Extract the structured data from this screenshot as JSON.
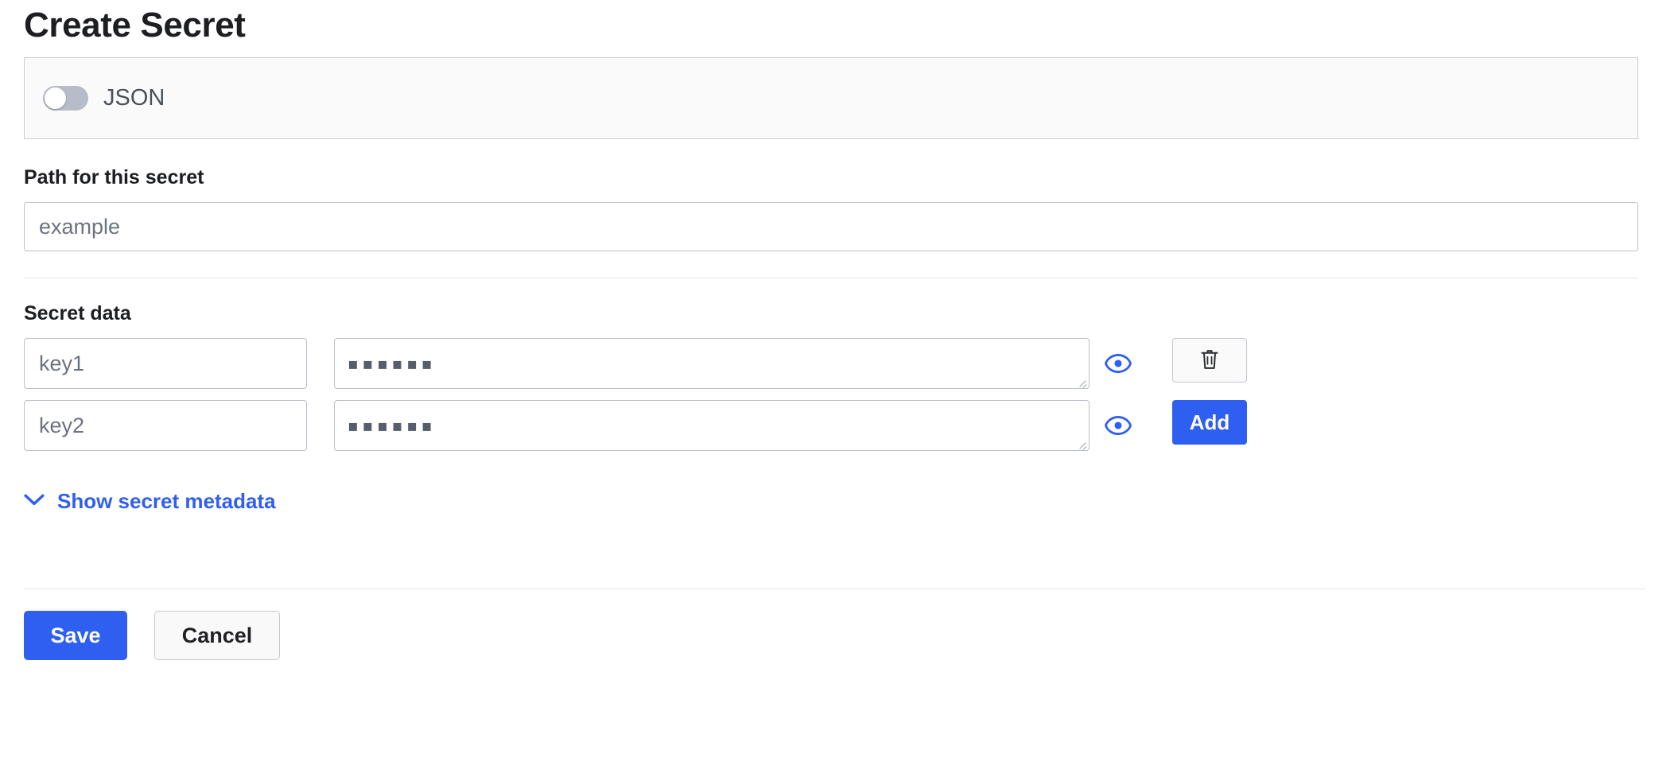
{
  "page": {
    "title": "Create Secret"
  },
  "json_toggle": {
    "label": "JSON",
    "state": "off",
    "icon": "toggle-switch-icon"
  },
  "path_field": {
    "label": "Path for this secret",
    "value": "",
    "placeholder": "example"
  },
  "secret_data": {
    "label": "Secret data",
    "rows": [
      {
        "key_value": "",
        "key_placeholder": "key1",
        "masked_value": "▪▪▪▪▪▪",
        "mask_char_count": 6,
        "reveal_icon": "eye-icon",
        "action_label": "",
        "action_icon": "trash-icon",
        "action_type": "delete"
      },
      {
        "key_value": "",
        "key_placeholder": "key2",
        "masked_value": "▪▪▪▪▪▪",
        "mask_char_count": 6,
        "reveal_icon": "eye-icon",
        "action_label": "Add",
        "action_icon": "",
        "action_type": "add"
      }
    ]
  },
  "metadata_toggle": {
    "label": "Show secret metadata",
    "icon": "chevron-down-icon"
  },
  "footer": {
    "save_label": "Save",
    "cancel_label": "Cancel"
  },
  "colors": {
    "accent_blue": "#2f5ff0",
    "border_gray": "#b9bfcb",
    "bar_background": "#fafafa",
    "text_dark": "#1c1e21",
    "placeholder_gray": "#6b7280",
    "toggle_track_off": "#b6bcc8",
    "mask_gray": "#565e6b"
  }
}
